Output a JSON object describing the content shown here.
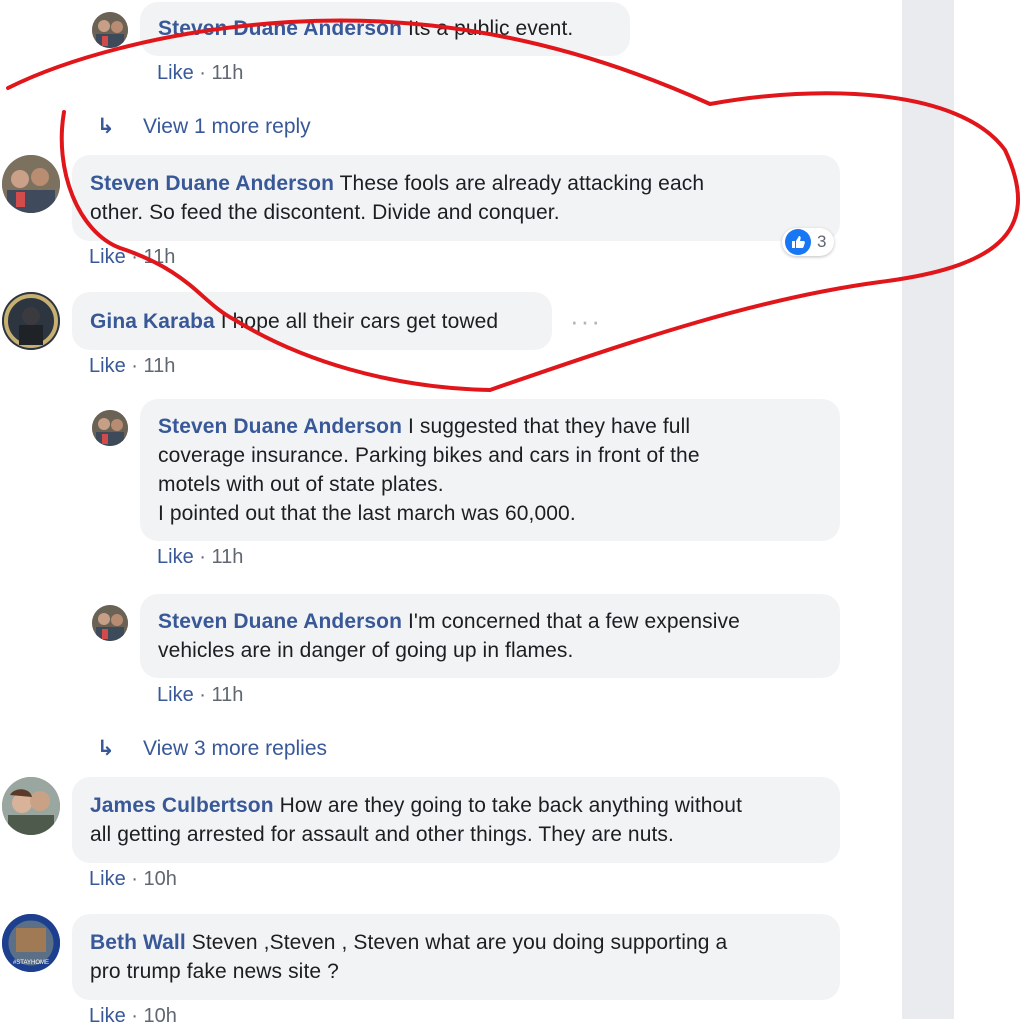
{
  "comments": [
    {
      "author": "Steven Duane Anderson",
      "text": "Its a public event.",
      "like": "Like",
      "sep": "·",
      "time": "11h"
    },
    {
      "view_more": "View 1 more reply"
    },
    {
      "author": "Steven Duane Anderson",
      "line1": "These fools are already attacking each",
      "line2": "other. So feed the discontent. Divide and conquer.",
      "like": "Like",
      "sep": "·",
      "time": "11h",
      "reaction_count": "3"
    },
    {
      "author": "Gina Karaba",
      "text": "I hope all their cars get towed",
      "like": "Like",
      "sep": "·",
      "time": "11h"
    },
    {
      "author": "Steven Duane Anderson",
      "line1": "I suggested that they have full",
      "line2": "coverage insurance. Parking bikes and cars in front of the",
      "line3": "motels with out of state plates.",
      "line4": "I pointed out that the last march was 60,000.",
      "like": "Like",
      "sep": "·",
      "time": "11h"
    },
    {
      "author": "Steven Duane Anderson",
      "line1": "I'm concerned that a few expensive",
      "line2": "vehicles are in danger of going up in flames.",
      "like": "Like",
      "sep": "·",
      "time": "11h"
    },
    {
      "view_more": "View 3 more replies"
    },
    {
      "author": "James Culbertson",
      "line1": "How are they going to take back anything without",
      "line2": "all getting arrested for assault and other things. They are nuts.",
      "like": "Like",
      "sep": "·",
      "time": "10h"
    },
    {
      "author": "Beth Wall",
      "line1": "Steven ,Steven , Steven what are you doing supporting a",
      "line2": "pro trump fake news site ?",
      "like": "Like",
      "sep": "·",
      "time": "10h",
      "avatar_badge": "#STAYHOME"
    }
  ],
  "colors": {
    "link": "#385898",
    "bubble": "#f2f3f5",
    "annotation": "#e0161b",
    "like_blue": "#1877f2"
  },
  "icons": {
    "reply_arrow": "reply-arrow-icon",
    "like_reaction": "thumbs-up-icon",
    "more_options": "more-options-icon"
  }
}
